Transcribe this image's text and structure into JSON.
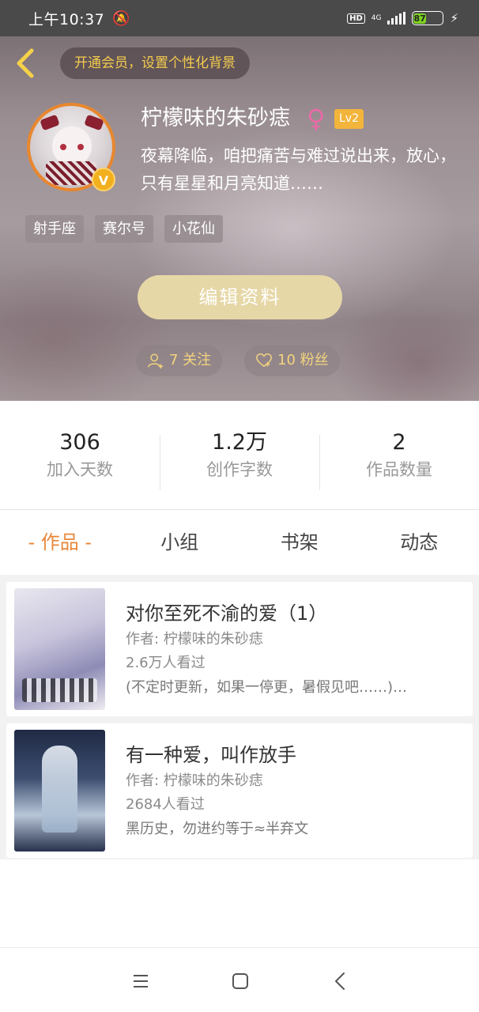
{
  "status_bar": {
    "time": "上午10:37",
    "hd": "HD",
    "network": "4G",
    "battery": "87"
  },
  "header": {
    "vip_banner": "开通会员，设置个性化背景",
    "username": "柠檬味的朱砂痣",
    "gender_symbol": "♀",
    "level": "Lv2",
    "verified_badge": "V",
    "bio": "夜幕降临，咱把痛苦与难过说出来，放心，只有星星和月亮知道……",
    "tags": [
      "射手座",
      "赛尔号",
      "小花仙"
    ],
    "edit_button": "编辑资料",
    "following": "7 关注",
    "followers": "10 粉丝"
  },
  "stats": [
    {
      "value": "306",
      "label": "加入天数"
    },
    {
      "value": "1.2万",
      "label": "创作字数"
    },
    {
      "value": "2",
      "label": "作品数量"
    }
  ],
  "tabs": {
    "works": "作品",
    "group": "小组",
    "bookshelf": "书架",
    "feed": "动态"
  },
  "works": [
    {
      "title": "对你至死不渝的爱（1）",
      "author": "作者: 柠檬味的朱砂痣",
      "views": "2.6万人看过",
      "desc": "(不定时更新，如果一停更，暑假见吧……)…"
    },
    {
      "title": "有一种爱，叫作放手",
      "author": "作者: 柠檬味的朱砂痣",
      "views": "2684人看过",
      "desc": "黑历史，勿进约等于≈半弃文"
    }
  ],
  "colors": {
    "accent": "#e8873a",
    "gold": "#f4cb4c",
    "edit_button": "#e6d7a6",
    "level_badge": "#f2b43a"
  },
  "icons": {
    "back": "chevron-left-icon",
    "follow": "user-plus-icon",
    "fans": "heart-plus-icon",
    "nav_menu": "menu-icon",
    "nav_home": "square-icon",
    "nav_back": "back-triangle-icon"
  }
}
